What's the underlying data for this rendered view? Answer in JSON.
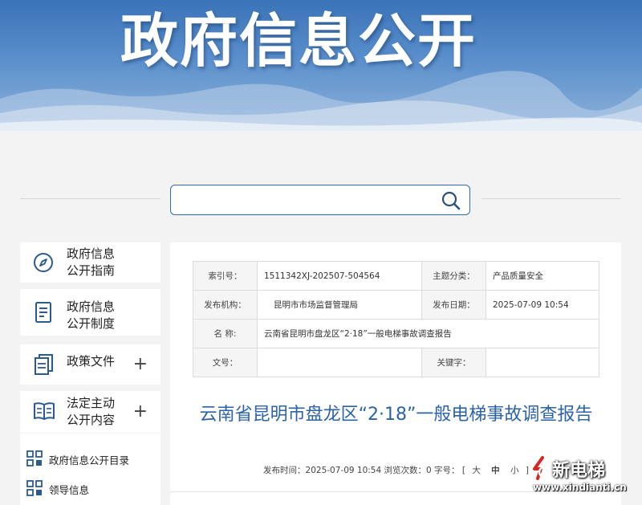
{
  "banner": {
    "title": "政府信息公开"
  },
  "search": {
    "placeholder": "",
    "value": ""
  },
  "sidebar": {
    "items": [
      {
        "label_line1": "政府信息",
        "label_line2": "公开指南",
        "icon": "compass-icon",
        "expandable": false
      },
      {
        "label_line1": "政府信息",
        "label_line2": "公开制度",
        "icon": "document-icon",
        "expandable": false
      },
      {
        "label_line1": "政策文件",
        "label_line2": "",
        "icon": "files-icon",
        "expandable": true
      },
      {
        "label_line1": "法定主动",
        "label_line2": "公开内容",
        "icon": "book-icon",
        "expandable": true
      }
    ],
    "plus": "+",
    "sub_items": [
      {
        "label": "政府信息公开目录",
        "icon": "grid-icon"
      },
      {
        "label": "领导信息",
        "icon": "grid-icon"
      }
    ]
  },
  "meta": {
    "index_label": "索引号：",
    "index_value": "1511342XJ-202507-504564",
    "topic_label": "主题分类：",
    "topic_value": "产品质量安全",
    "publisher_label": "发布机构：",
    "publisher_value": "昆明市市场监督管理局",
    "date_label": "发布日期：",
    "date_value": "2025-07-09 10:54",
    "name_label": "名 称:",
    "name_value": "云南省昆明市盘龙区“2·18”一般电梯事故调查报告",
    "docno_label": "文号：",
    "docno_value": "",
    "keyword_label": "关键字：",
    "keyword_value": ""
  },
  "article": {
    "title": "云南省昆明市盘龙区“2·18”一般电梯事故调查报告",
    "publish_label": "发布时间：2025-07-09 10:54",
    "views_label": "浏览次数：0",
    "fontsize_label": "字号：",
    "bracket_open": "[",
    "size_large": "大",
    "size_medium": "中",
    "size_small": "小",
    "bracket_close": "]"
  },
  "watermark": {
    "brand": "新电梯",
    "url": "www.xindianti.cn"
  },
  "colors": {
    "accent": "#2b63a8",
    "border": "#2d6db5",
    "banner": "#3a73b8"
  }
}
